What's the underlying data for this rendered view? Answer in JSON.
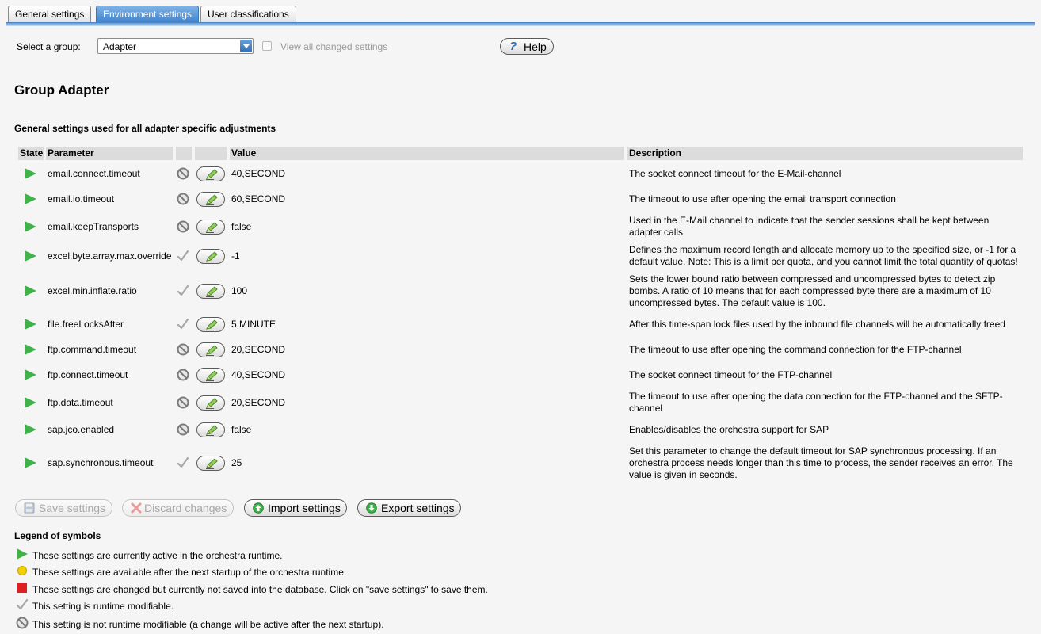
{
  "tabs": [
    {
      "label": "General settings",
      "active": false
    },
    {
      "label": "Environment settings",
      "active": true
    },
    {
      "label": "User classifications",
      "active": false
    }
  ],
  "toolbar": {
    "select_label": "Select a group:",
    "group_value": "Adapter",
    "view_changed_label": "View all changed settings",
    "view_changed_checked": false,
    "help_label": "Help"
  },
  "group": {
    "title": "Group Adapter",
    "subtitle": "General settings used for all adapter specific adjustments"
  },
  "table": {
    "headers": {
      "state": "State",
      "parameter": "Parameter",
      "value": "Value",
      "description": "Description"
    },
    "rows": [
      {
        "state": "active",
        "parameter": "email.connect.timeout",
        "runtime_modifiable": false,
        "value": "40,SECOND",
        "description": "The socket connect timeout for the E-Mail-channel"
      },
      {
        "state": "active",
        "parameter": "email.io.timeout",
        "runtime_modifiable": false,
        "value": "60,SECOND",
        "description": "The timeout to use after opening the email transport connection"
      },
      {
        "state": "active",
        "parameter": "email.keepTransports",
        "runtime_modifiable": false,
        "value": "false",
        "description": "Used in the E-Mail channel to indicate that the sender sessions shall be kept between adapter calls"
      },
      {
        "state": "active",
        "parameter": "excel.byte.array.max.override",
        "runtime_modifiable": true,
        "value": "-1",
        "description": "Defines the maximum record length and allocate memory up to the specified size, or -1 for a default value. Note: This is a limit per quota, and you cannot limit the total quantity of quotas!"
      },
      {
        "state": "active",
        "parameter": "excel.min.inflate.ratio",
        "runtime_modifiable": true,
        "value": "100",
        "description": "Sets the lower bound ratio between compressed and uncompressed bytes to detect zip bombs. A ratio of 10 means that for each compressed byte there are a maximum of 10 uncompressed bytes. The default value is 100."
      },
      {
        "state": "active",
        "parameter": "file.freeLocksAfter",
        "runtime_modifiable": true,
        "value": "5,MINUTE",
        "description": "After this time-span lock files used by the inbound file channels will be automatically freed"
      },
      {
        "state": "active",
        "parameter": "ftp.command.timeout",
        "runtime_modifiable": false,
        "value": "20,SECOND",
        "description": "The timeout to use after opening the command connection for the FTP-channel"
      },
      {
        "state": "active",
        "parameter": "ftp.connect.timeout",
        "runtime_modifiable": false,
        "value": "40,SECOND",
        "description": "The socket connect timeout for the FTP-channel"
      },
      {
        "state": "active",
        "parameter": "ftp.data.timeout",
        "runtime_modifiable": false,
        "value": "20,SECOND",
        "description": "The timeout to use after opening the data connection for the FTP-channel and the SFTP-channel"
      },
      {
        "state": "active",
        "parameter": "sap.jco.enabled",
        "runtime_modifiable": false,
        "value": "false",
        "description": "Enables/disables the orchestra support for SAP"
      },
      {
        "state": "active",
        "parameter": "sap.synchronous.timeout",
        "runtime_modifiable": true,
        "value": "25",
        "description": "Set this parameter to change the default timeout for SAP synchronous processing. If an orchestra process needs longer than this time to process, the sender receives an error. The value is given in seconds."
      }
    ]
  },
  "actions": {
    "save": "Save settings",
    "discard": "Discard changes",
    "import": "Import settings",
    "export": "Export settings"
  },
  "legend": {
    "title": "Legend of symbols",
    "items": [
      {
        "icon": "green-triangle-icon",
        "text": "These settings are currently active in the orchestra runtime."
      },
      {
        "icon": "yellow-circle-icon",
        "text": "These settings are available after the next startup of the orchestra runtime."
      },
      {
        "icon": "red-square-icon",
        "text": "These settings are changed but currently not saved into the database. Click on \"save settings\" to save them."
      },
      {
        "icon": "checkmark-icon",
        "text": "This setting is runtime modifiable."
      },
      {
        "icon": "no-entry-icon",
        "text": "This setting is not runtime modifiable (a change will be active after the next startup)."
      }
    ]
  },
  "colors": {
    "active_green": "#3fb34a",
    "pending_yellow": "#f5d000",
    "unsaved_red": "#e02020",
    "tab_active_blue": "#3f82cc"
  }
}
